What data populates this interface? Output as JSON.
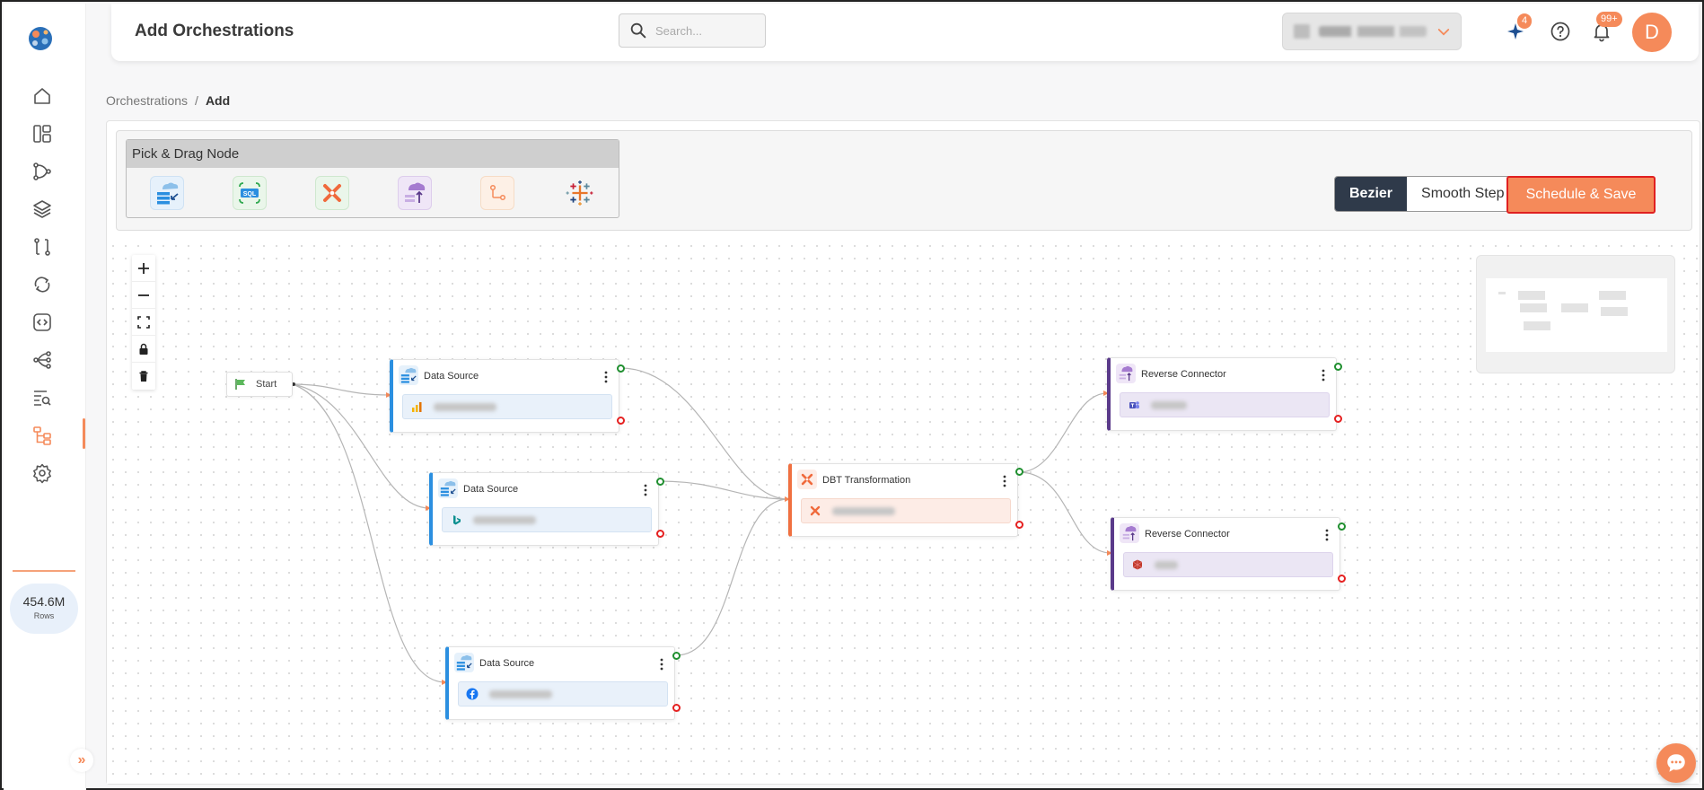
{
  "header": {
    "title": "Add Orchestrations",
    "search_placeholder": "Search...",
    "ai_badge": "4",
    "notifications_badge": "99+",
    "avatar_initial": "D"
  },
  "sidebar": {
    "rows_value": "454.6M",
    "rows_label": "Rows",
    "items": [
      "home-icon",
      "dashboard-icon",
      "pipeline-icon",
      "layers-icon",
      "compare-icon",
      "sync-icon",
      "code-icon",
      "flow-icon",
      "query-icon",
      "orchestration-icon",
      "settings-icon"
    ],
    "active_item": "orchestration-icon"
  },
  "breadcrumb": {
    "parent": "Orchestrations",
    "separator": "/",
    "current": "Add"
  },
  "palette": {
    "title": "Pick & Drag Node",
    "items": [
      "data-source-node-icon",
      "sql-node-icon",
      "dbt-node-icon",
      "reverse-connector-node-icon",
      "branch-node-icon",
      "tableau-node-icon"
    ]
  },
  "toolbar": {
    "edge_options": [
      "Bezier",
      "Smooth Step"
    ],
    "selected_edge": "Bezier",
    "save_label": "Schedule & Save"
  },
  "flow": {
    "start_label": "Start",
    "nodes": [
      {
        "id": "ds1",
        "type": "data-source",
        "title": "Data Source",
        "connector_icon": "bar-chart-icon"
      },
      {
        "id": "ds2",
        "type": "data-source",
        "title": "Data Source",
        "connector_icon": "bing-icon"
      },
      {
        "id": "ds3",
        "type": "data-source",
        "title": "Data Source",
        "connector_icon": "facebook-icon"
      },
      {
        "id": "dbt1",
        "type": "dbt-transformation",
        "title": "DBT Transformation",
        "connector_icon": "dbt-icon"
      },
      {
        "id": "rc1",
        "type": "reverse-connector",
        "title": "Reverse Connector",
        "connector_icon": "teams-icon"
      },
      {
        "id": "rc2",
        "type": "reverse-connector",
        "title": "Reverse Connector",
        "connector_icon": "red-cube-icon"
      }
    ]
  },
  "colors": {
    "accent": "#f58a5a",
    "data_source": "#2b8fe0",
    "dbt": "#f07040",
    "reverse_connector": "#5a3a8a",
    "success_handle": "#1f8f2f",
    "error_handle": "#e52020",
    "edge_dark": "#2f3a4a"
  }
}
